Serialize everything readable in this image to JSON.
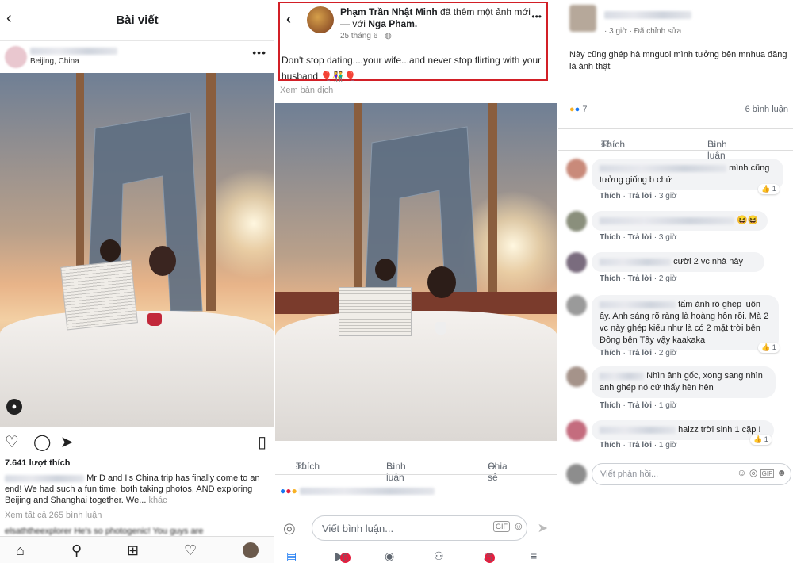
{
  "instagram": {
    "header_title": "Bài viết",
    "location": "Beijing, China",
    "likes": "7.641 lượt thích",
    "caption": "Mr D and I's China trip has finally come to an end! We had such a fun time, both taking photos, AND exploring Beijing and Shanghai together. We...",
    "more_label": "khác",
    "view_all": "Xem tất cả 265 bình luận",
    "comment_preview": "elsaththeexplorer He's so photogenic!  You guys are"
  },
  "facebook": {
    "poster_name": "Phạm Trần Nhật Minh",
    "action_text": "đã thêm một ảnh mới — với",
    "tagged_name": "Nga Pham.",
    "time": "25 tháng 6 · ",
    "post_text": "Don't stop dating....your wife...and never stop flirting with your husband",
    "translate": "Xem bản dịch",
    "like_label": "Thích",
    "comment_label": "Bình luận",
    "share_label": "Chia sẻ",
    "compose_placeholder": "Viết bình luận...",
    "gif_label": "GIF",
    "badge_video": "6",
    "badge_notif": "5"
  },
  "comments": {
    "meta": "· 3 giờ · Đã chỉnh sửa",
    "post_text": "Này cũng ghép hả mnguoi mình tưởng bên mnhua đăng là ảnh thật",
    "reaction_count": "7",
    "comment_count": "6 bình luận",
    "like_label": "Thích",
    "comment_label": "Bình luận",
    "reply_label": "Trả lời",
    "items": [
      {
        "text": "mình cũng tưởng giống b chứ",
        "time": "3 giờ",
        "likes": "1"
      },
      {
        "text": "😆😆",
        "time": "3 giờ",
        "likes": ""
      },
      {
        "text": "cười   2 vc nhà này",
        "time": "2 giờ",
        "likes": ""
      },
      {
        "text": "tấm ảnh rõ ghép luôn ấy. Anh sáng rõ ràng là hoàng hôn rồi. Mà 2 vc này ghép kiểu như là có 2 mặt trời bên Đông bên Tây vậy kaakaka",
        "time": "2 giờ",
        "likes": "1"
      },
      {
        "text": "Nhìn ảnh gốc, xong sang nhìn anh ghép nó cứ thấy hèn hèn",
        "time": "1 giờ",
        "likes": ""
      },
      {
        "text": "haizz trời sinh 1 cặp !",
        "time": "1 giờ",
        "likes": "1"
      }
    ],
    "compose_placeholder": "Viết phản hồi..."
  }
}
